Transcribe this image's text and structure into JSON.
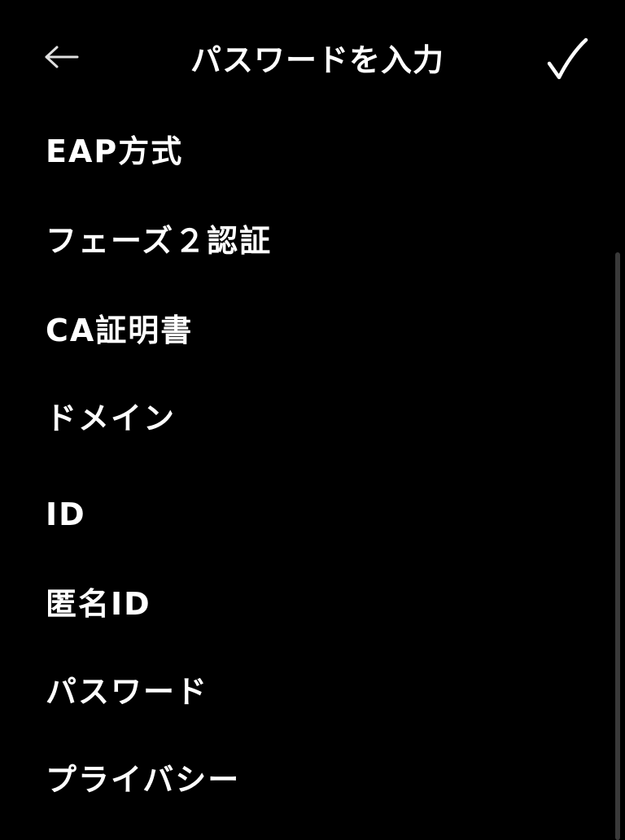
{
  "colors": {
    "background": "#000000",
    "text": "#ffffff",
    "scrollbar": "#3a3a3a"
  },
  "header": {
    "back_icon": "arrow-left-icon",
    "title": "パスワードを入力",
    "confirm_icon": "checkmark-icon"
  },
  "settings": {
    "items": [
      {
        "label": "EAP方式"
      },
      {
        "label": "フェーズ２認証"
      },
      {
        "label": "CA証明書"
      },
      {
        "label": "ドメイン"
      },
      {
        "label": "ID"
      },
      {
        "label": "匿名ID"
      },
      {
        "label": "パスワード"
      },
      {
        "label": "プライバシー"
      }
    ]
  }
}
